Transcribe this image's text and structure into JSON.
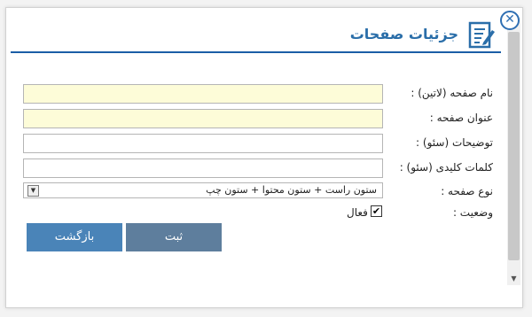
{
  "dialog": {
    "title": "جزئیات صفحات",
    "close_glyph": "✕",
    "header_icon": "edit-document-icon",
    "accent_color": "#2a6ea9"
  },
  "form": {
    "fields": [
      {
        "label": "نام صفحه (لاتین) :",
        "value": "",
        "placeholder": ""
      },
      {
        "label": "عنوان صفحه :",
        "value": "",
        "placeholder": ""
      },
      {
        "label": "توضیحات (سئو) :",
        "value": "",
        "placeholder": ""
      },
      {
        "label": "کلمات کلیدی (سئو) :",
        "value": "",
        "placeholder": ""
      }
    ],
    "page_type": {
      "label": "نوع صفحه :",
      "selected": "ستون راست + ستون محتوا + ستون چپ"
    },
    "status": {
      "label": "وضعیت :",
      "checkbox_label": "فعال",
      "checked": true,
      "check_glyph": "✔"
    }
  },
  "buttons": {
    "back_label": "بازگشت",
    "submit_label": "ثبت"
  },
  "scrollbar": {
    "up_glyph": "▲",
    "down_glyph": "▼"
  }
}
